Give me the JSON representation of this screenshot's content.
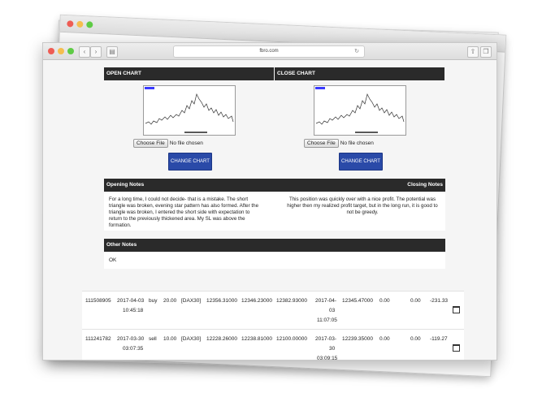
{
  "browser": {
    "url": "fbro.com"
  },
  "charts": {
    "open": {
      "header": "OPEN CHART",
      "choose_label": "Choose File",
      "file_status": "No file chosen",
      "change_label": "CHANGE CHART"
    },
    "close": {
      "header": "CLOSE CHART",
      "choose_label": "Choose File",
      "file_status": "No file chosen",
      "change_label": "CHANGE CHART"
    }
  },
  "notes": {
    "opening_header": "Opening Notes",
    "closing_header": "Closing Notes",
    "opening_text": "For a long time, I could not decide- that is a mistake. The short triangle was broken, evening star pattern has also formed. After the triangle was broken, I entered the short side with expectation to return to the previously thickened area. My SL was above the formation.",
    "closing_text": "This position was quickly over with a nice profit. The potential was higher then my realized profit target, but in the long run, it is good to not be greedy.",
    "other_header": "Other Notes",
    "other_text": "OK"
  },
  "trades": [
    {
      "id": "111508905",
      "open_date": "2017-04-03",
      "open_time": "10:45:18",
      "direction": "buy",
      "volume": "20.00",
      "symbol": "[DAX30]",
      "open_price": "12356.31000",
      "sl": "12346.23000",
      "tp": "12382.93000",
      "close_date_a": "2017-04-",
      "close_date_b": "03",
      "close_time": "11:07:05",
      "close_price": "12345.47000",
      "commission": "0.00",
      "swap": "0.00",
      "profit": "-231.33"
    },
    {
      "id": "111241782",
      "open_date": "2017-03-30",
      "open_time": "03:07:35",
      "direction": "sell",
      "volume": "10.00",
      "symbol": "[DAX30]",
      "open_price": "12228.26000",
      "sl": "12238.81000",
      "tp": "12100.00000",
      "close_date_a": "2017-03-",
      "close_date_b": "30",
      "close_time": "03:09:15",
      "close_price": "12239.35000",
      "commission": "0.00",
      "swap": "0.00",
      "profit": "-119.27"
    }
  ],
  "colors": {
    "header_bg": "#2a2a2a",
    "button_blue": "#2a4aa8"
  }
}
